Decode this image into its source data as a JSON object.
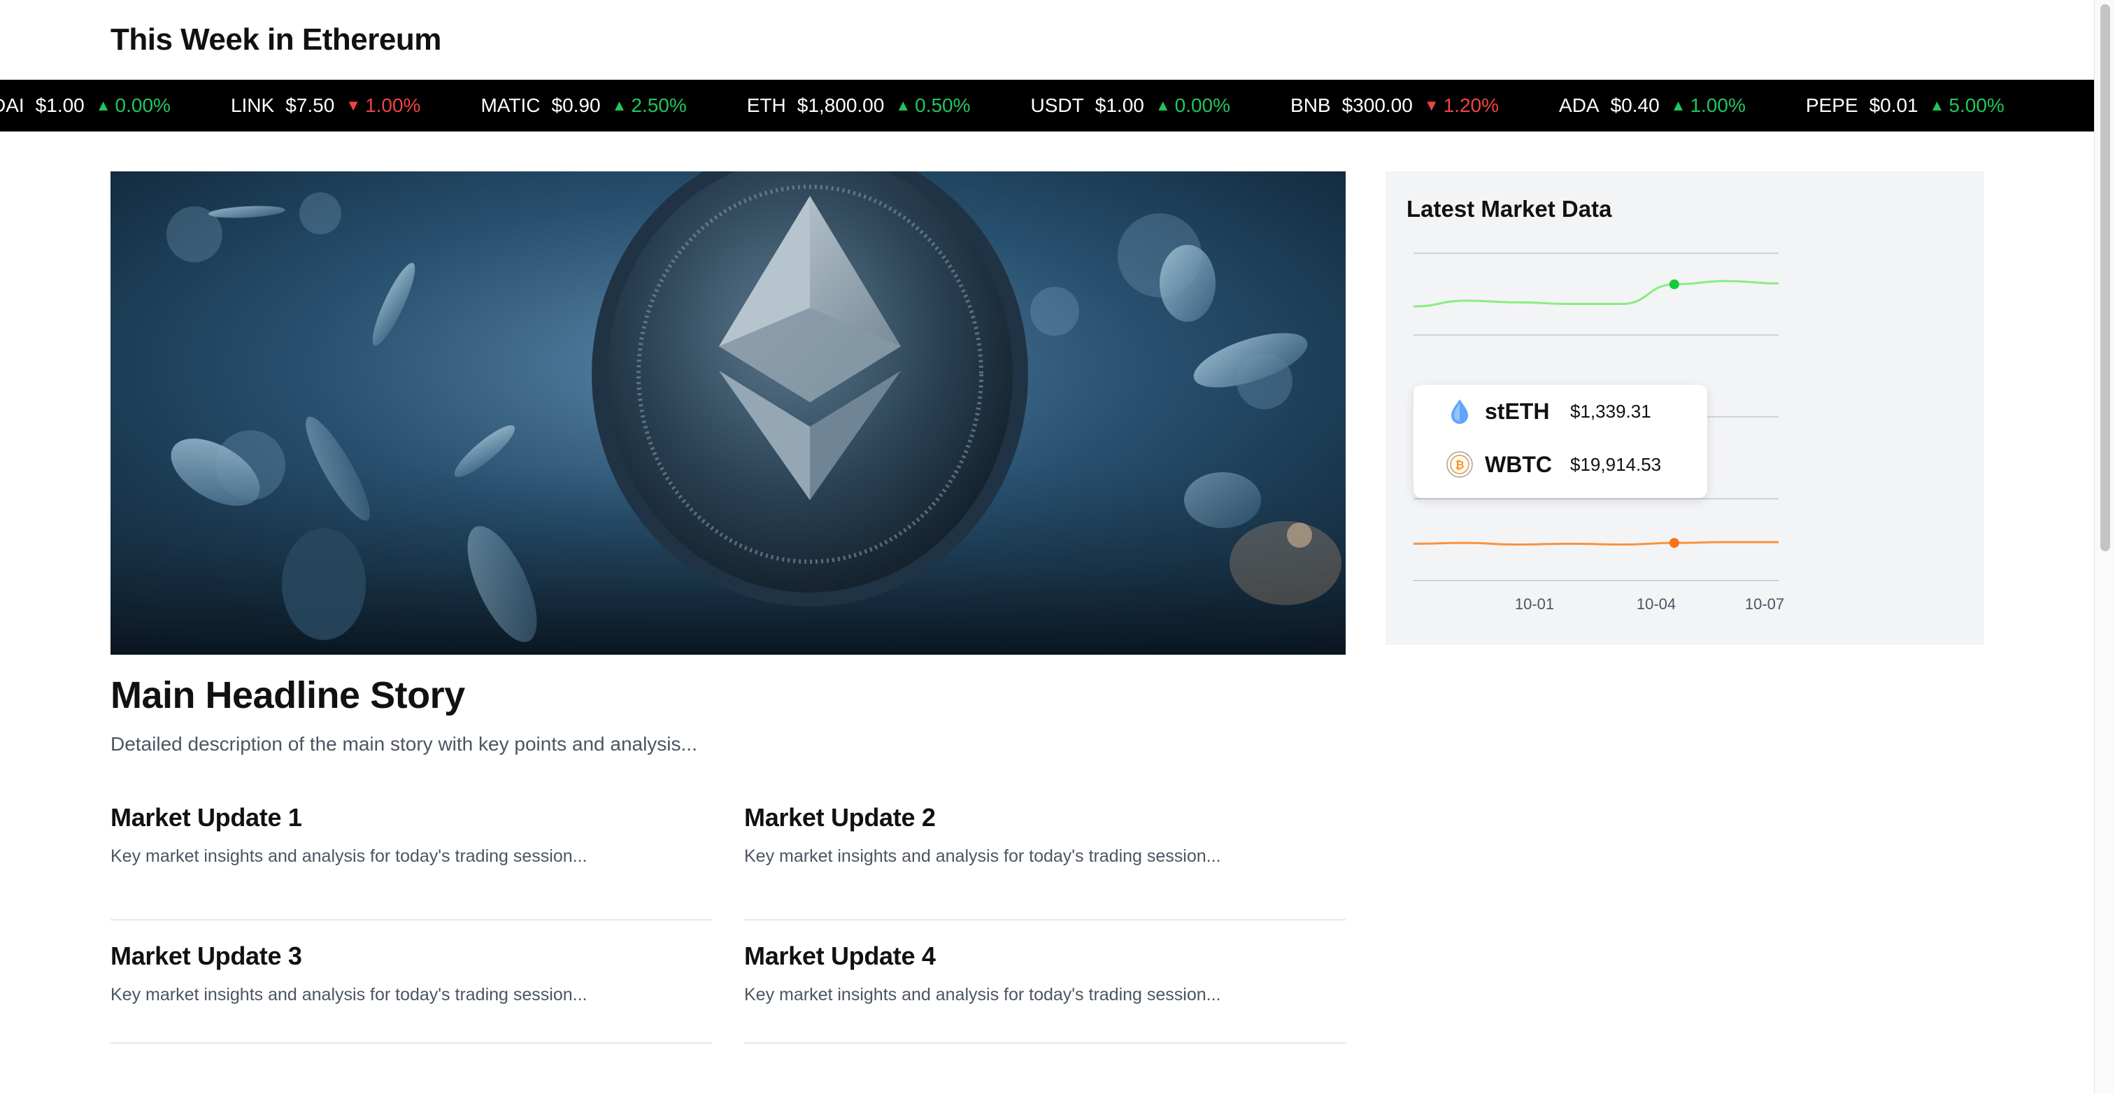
{
  "header": {
    "title": "This Week in Ethereum"
  },
  "ticker": [
    {
      "symbol": "DAI",
      "price": "$1.00",
      "direction": "up",
      "arrow": "▲",
      "change": "0.00%"
    },
    {
      "symbol": "LINK",
      "price": "$7.50",
      "direction": "down",
      "arrow": "▼",
      "change": "1.00%"
    },
    {
      "symbol": "MATIC",
      "price": "$0.90",
      "direction": "up",
      "arrow": "▲",
      "change": "2.50%"
    },
    {
      "symbol": "ETH",
      "price": "$1,800.00",
      "direction": "up",
      "arrow": "▲",
      "change": "0.50%"
    },
    {
      "symbol": "USDT",
      "price": "$1.00",
      "direction": "up",
      "arrow": "▲",
      "change": "0.00%"
    },
    {
      "symbol": "BNB",
      "price": "$300.00",
      "direction": "down",
      "arrow": "▼",
      "change": "1.20%"
    },
    {
      "symbol": "ADA",
      "price": "$0.40",
      "direction": "up",
      "arrow": "▲",
      "change": "1.00%"
    },
    {
      "symbol": "PEPE",
      "price": "$0.01",
      "direction": "up",
      "arrow": "▲",
      "change": "5.00%"
    }
  ],
  "main": {
    "hero_image": "ethereum-coin-image",
    "headline": "Main Headline Story",
    "description": "Detailed description of the main story with key points and analysis...",
    "updates": [
      {
        "title": "Market Update 1",
        "text": "Key market insights and analysis for today's trading session..."
      },
      {
        "title": "Market Update 2",
        "text": "Key market insights and analysis for today's trading session..."
      },
      {
        "title": "Market Update 3",
        "text": "Key market insights and analysis for today's trading session..."
      },
      {
        "title": "Market Update 4",
        "text": "Key market insights and analysis for today's trading session..."
      }
    ]
  },
  "sidebar": {
    "title": "Latest Market Data",
    "tooltip": [
      {
        "name": "stETH",
        "price": "$1,339.31",
        "icon": "steth-icon"
      },
      {
        "name": "WBTC",
        "price": "$19,914.53",
        "icon": "wbtc-icon"
      }
    ]
  },
  "colors": {
    "up": "#22c55e",
    "down": "#ef4444",
    "steth_line": "#86ef7d",
    "wbtc_line": "#fb923c"
  },
  "chart_data": {
    "type": "line",
    "x_ticks": [
      "10-01",
      "10-04",
      "10-07"
    ],
    "series": [
      {
        "name": "stETH",
        "values": [
          0.35,
          0.42,
          0.4,
          0.38,
          0.38,
          0.62,
          0.66,
          0.63
        ],
        "highlight_index": 5
      },
      {
        "name": "WBTC",
        "values": [
          0.45,
          0.46,
          0.44,
          0.45,
          0.44,
          0.46,
          0.47,
          0.47
        ],
        "highlight_index": 5
      }
    ],
    "grid": true,
    "legend": "none"
  }
}
